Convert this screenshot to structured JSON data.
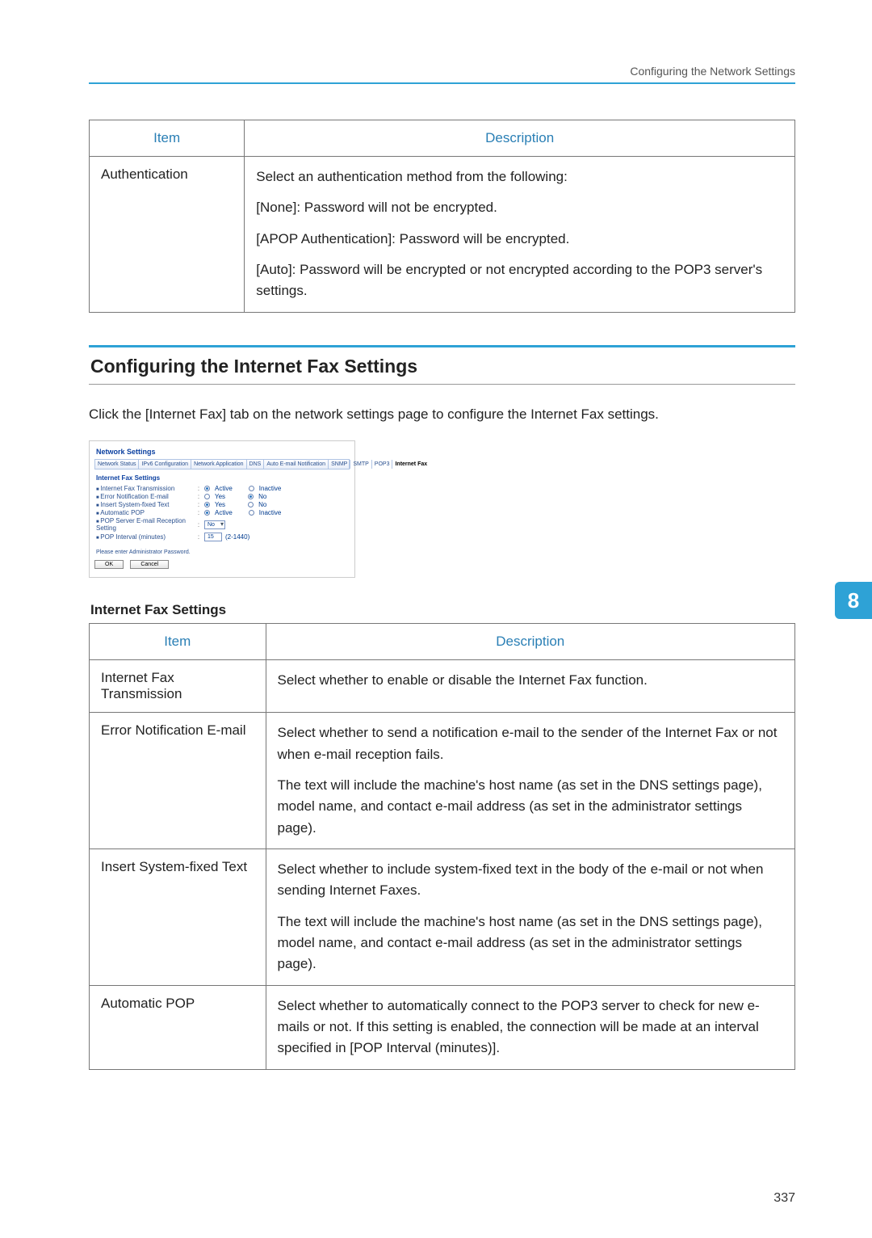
{
  "running_head": "Configuring the Network Settings",
  "table1": {
    "head_item": "Item",
    "head_desc": "Description",
    "row1_item": "Authentication",
    "row1_p1": "Select an authentication method from the following:",
    "row1_p2": "[None]: Password will not be encrypted.",
    "row1_p3": "[APOP Authentication]: Password will be encrypted.",
    "row1_p4": "[Auto]: Password will be encrypted or not encrypted according to the POP3 server's settings."
  },
  "section_title": "Configuring the Internet Fax Settings",
  "lead": "Click the [Internet Fax] tab on the network settings page to configure the Internet Fax settings.",
  "screenshot": {
    "title": "Network Settings",
    "tabs": [
      "Network Status",
      "IPv6 Configuration",
      "Network Application",
      "DNS",
      "Auto E-mail Notification",
      "SNMP",
      "SMTP",
      "POP3",
      "Internet Fax"
    ],
    "group": "Internet Fax Settings",
    "r1_label": "Internet Fax Transmission",
    "r2_label": "Error Notification E-mail",
    "r3_label": "Insert System-fixed Text",
    "r4_label": "Automatic POP",
    "r5_label": "POP Server E-mail Reception Setting",
    "r6_label": "POP Interval (minutes)",
    "active": "Active",
    "inactive": "Inactive",
    "yes": "Yes",
    "no": "No",
    "select_no": "No",
    "interval_value": "15",
    "interval_hint": "(2-1440)",
    "note": "Please enter Administrator Password.",
    "ok": "OK",
    "cancel": "Cancel"
  },
  "sub_heading": "Internet Fax Settings",
  "table2": {
    "head_item": "Item",
    "head_desc": "Description",
    "rows": [
      {
        "item": "Internet Fax Transmission",
        "paras": [
          "Select whether to enable or disable the Internet Fax function."
        ]
      },
      {
        "item": "Error Notification E-mail",
        "paras": [
          "Select whether to send a notification e-mail to the sender of the Internet Fax or not when e-mail reception fails.",
          "The text will include the machine's host name (as set in the DNS settings page), model name, and contact e-mail address (as set in the administrator settings page)."
        ]
      },
      {
        "item": "Insert System-fixed Text",
        "paras": [
          "Select whether to include system-fixed text in the body of the e-mail or not when sending Internet Faxes.",
          "The text will include the machine's host name (as set in the DNS settings page), model name, and contact e-mail address (as set in the administrator settings page)."
        ]
      },
      {
        "item": "Automatic POP",
        "paras": [
          "Select whether to automatically connect to the POP3 server to check for new e-mails or not. If this setting is enabled, the connection will be made at an interval specified in [POP Interval (minutes)]."
        ]
      }
    ]
  },
  "side_tab": "8",
  "page_number": "337"
}
